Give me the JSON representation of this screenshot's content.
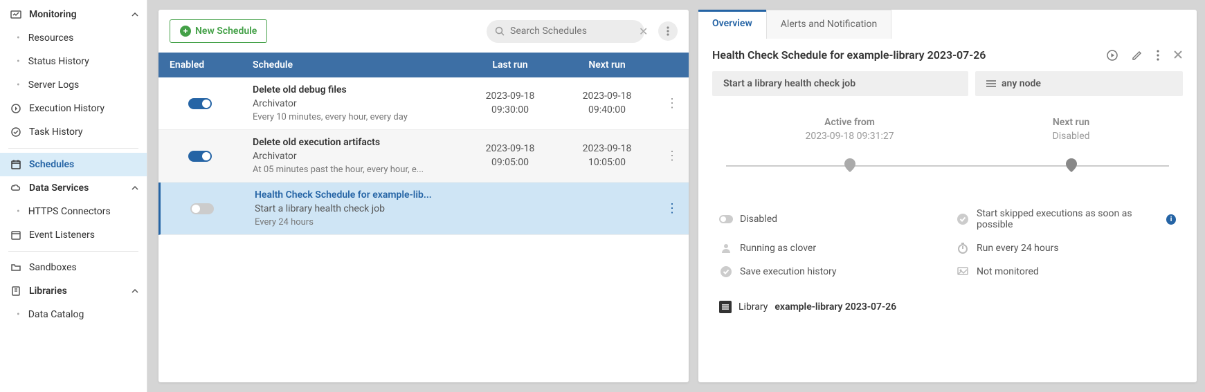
{
  "sidebar": {
    "monitoring": {
      "label": "Monitoring",
      "resources": "Resources",
      "status_history": "Status History",
      "server_logs": "Server Logs"
    },
    "execution_history": "Execution History",
    "task_history": "Task History",
    "schedules": "Schedules",
    "data_services": {
      "label": "Data Services",
      "https_connectors": "HTTPS Connectors"
    },
    "event_listeners": "Event Listeners",
    "sandboxes": "Sandboxes",
    "libraries": {
      "label": "Libraries",
      "data_catalog": "Data Catalog"
    }
  },
  "toolbar": {
    "new_schedule": "New Schedule",
    "search_placeholder": "Search Schedules"
  },
  "headers": {
    "enabled": "Enabled",
    "schedule": "Schedule",
    "last_run": "Last run",
    "next_run": "Next run"
  },
  "rows": [
    {
      "title": "Delete old debug files",
      "subtitle": "Archivator",
      "desc": "Every 10 minutes, every hour, every day",
      "last_date": "2023-09-18",
      "last_time": "09:30:00",
      "next_date": "2023-09-18",
      "next_time": "09:40:00",
      "enabled": true
    },
    {
      "title": "Delete old execution artifacts",
      "subtitle": "Archivator",
      "desc": "At 05 minutes past the hour, every hour, e...",
      "last_date": "2023-09-18",
      "last_time": "09:05:00",
      "next_date": "2023-09-18",
      "next_time": "10:05:00",
      "enabled": true
    },
    {
      "title": "Health Check Schedule for example-lib...",
      "subtitle": "Start a library health check job",
      "desc": "Every 24 hours",
      "enabled": false
    }
  ],
  "detail": {
    "tabs": {
      "overview": "Overview",
      "alerts": "Alerts and Notification"
    },
    "title": "Health Check Schedule for example-library 2023-07-26",
    "job_label": "Start a library health check job",
    "node_label": "any node",
    "timeline": {
      "active_label": "Active from",
      "active_value": "2023-09-18 09:31:27",
      "next_label": "Next run",
      "next_value": "Disabled"
    },
    "props": {
      "disabled": "Disabled",
      "skipped": "Start skipped executions as soon as possible",
      "running_as": "Running as clover",
      "run_every": "Run every 24 hours",
      "save_history": "Save execution history",
      "not_monitored": "Not monitored"
    },
    "library": {
      "prefix": "Library",
      "name": "example-library 2023-07-26"
    }
  }
}
